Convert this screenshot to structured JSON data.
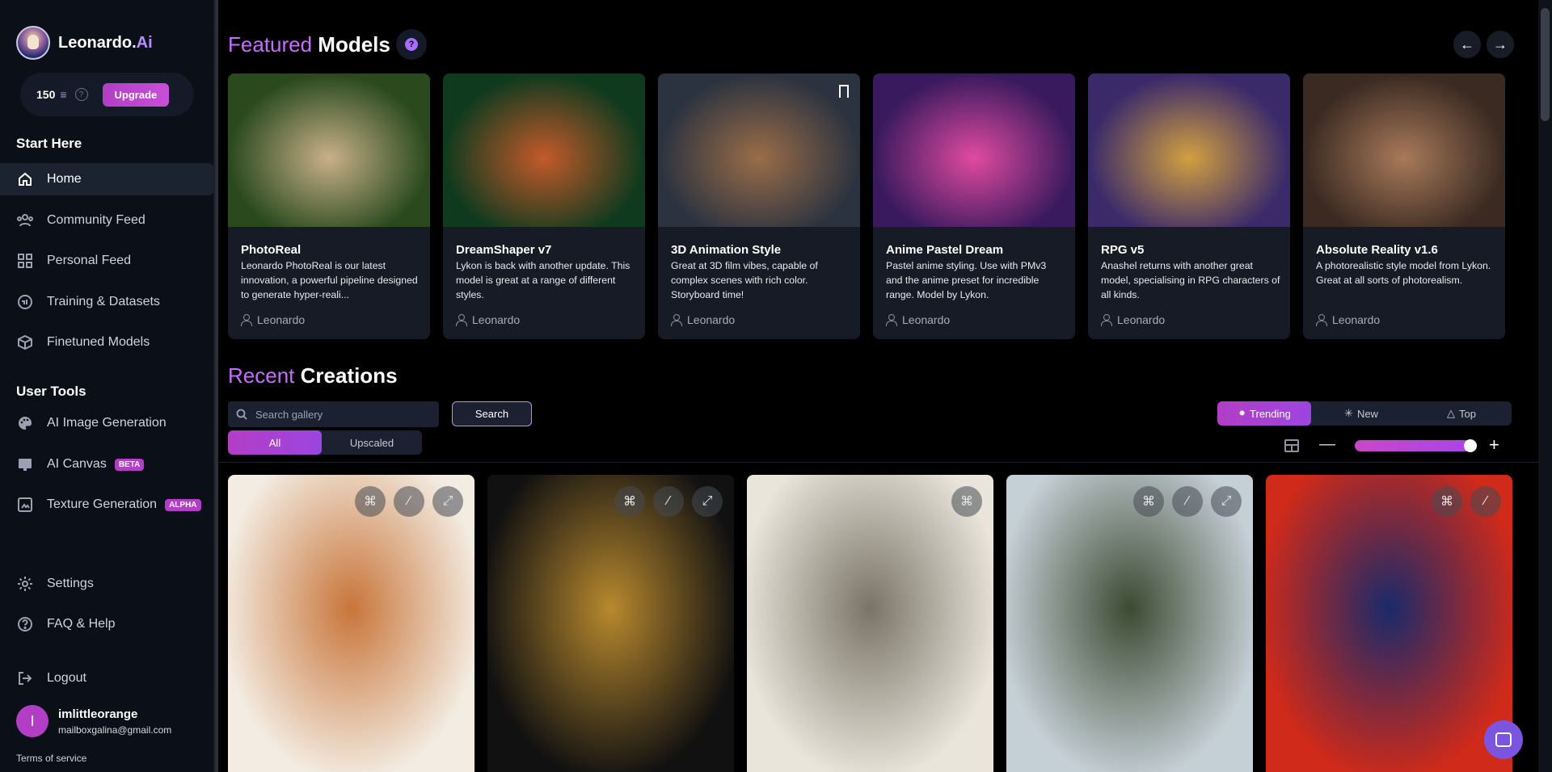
{
  "app": {
    "name_prefix": "Leonardo.",
    "name_suffix": "Ai"
  },
  "credits": {
    "amount": "150",
    "upgrade_label": "Upgrade"
  },
  "sidebar": {
    "start_title": "Start Here",
    "start_items": [
      {
        "label": "Home",
        "icon": "home-icon",
        "active": true
      },
      {
        "label": "Community Feed",
        "icon": "users-icon"
      },
      {
        "label": "Personal Feed",
        "icon": "grid-icon"
      },
      {
        "label": "Training & Datasets",
        "icon": "brain-icon"
      },
      {
        "label": "Finetuned Models",
        "icon": "cube-icon"
      }
    ],
    "tools_title": "User Tools",
    "tool_items": [
      {
        "label": "AI Image Generation",
        "icon": "palette-icon"
      },
      {
        "label": "AI Canvas",
        "icon": "canvas-icon",
        "badge": "BETA"
      },
      {
        "label": "Texture Generation",
        "icon": "texture-icon",
        "badge": "ALPHA"
      }
    ],
    "bottom_items": [
      {
        "label": "Settings",
        "icon": "gear-icon"
      },
      {
        "label": "FAQ & Help",
        "icon": "help-icon"
      },
      {
        "label": "Logout",
        "icon": "logout-icon"
      }
    ],
    "user": {
      "initial": "I",
      "name": "imlittleorange",
      "email": "mailboxgalina@gmail.com"
    },
    "terms": "Terms of service"
  },
  "featured": {
    "title_highlight": "Featured",
    "title_rest": " Models",
    "models": [
      {
        "name": "PhotoReal",
        "desc": "Leonardo PhotoReal is our latest innovation, a powerful pipeline designed to generate hyper-reali...",
        "author": "Leonardo",
        "colors": [
          "#2a4a1e",
          "#c9b089"
        ]
      },
      {
        "name": "DreamShaper v7",
        "desc": "Lykon is back with another update. This model is great at a range of different styles.",
        "author": "Leonardo",
        "colors": [
          "#0f3a1e",
          "#c45a2a"
        ]
      },
      {
        "name": "3D Animation Style",
        "desc": "Great at 3D film vibes, capable of complex scenes with rich color. Storyboard time!",
        "author": "Leonardo",
        "colors": [
          "#2c3340",
          "#9a6d48"
        ]
      },
      {
        "name": "Anime Pastel Dream",
        "desc": "Pastel anime styling. Use with PMv3 and the anime preset for incredible range. Model by Lykon.",
        "author": "Leonardo",
        "colors": [
          "#3a1a5e",
          "#e04aa0"
        ]
      },
      {
        "name": "RPG v5",
        "desc": "Anashel returns with another great model, specialising in RPG characters of all kinds.",
        "author": "Leonardo",
        "colors": [
          "#3a2a6a",
          "#d2a040"
        ]
      },
      {
        "name": "Absolute Reality v1.6",
        "desc": "A photorealistic style model from Lykon. Great at all sorts of photorealism.",
        "author": "Leonardo",
        "colors": [
          "#3a2a22",
          "#a87a5a"
        ]
      }
    ]
  },
  "recent": {
    "title_highlight": "Recent",
    "title_rest": " Creations",
    "search_placeholder": "Search gallery",
    "search_label": "Search",
    "filter_tabs": [
      "All",
      "Upscaled"
    ],
    "sort_tabs": [
      "Trending",
      "New",
      "Top"
    ],
    "images": [
      {
        "name": "autumn-trees-pattern",
        "colors": [
          "#f3ece2",
          "#c8753a"
        ]
      },
      {
        "name": "golden-skull-hood",
        "colors": [
          "#111111",
          "#b8892e"
        ]
      },
      {
        "name": "tree-sketch",
        "colors": [
          "#e9e5da",
          "#7a7468"
        ]
      },
      {
        "name": "soldier-woman-portrait",
        "colors": [
          "#c5cfd6",
          "#3d4a32"
        ]
      },
      {
        "name": "doctor-strange-portrait",
        "colors": [
          "#cf2a1a",
          "#1a2a6a"
        ]
      }
    ]
  }
}
